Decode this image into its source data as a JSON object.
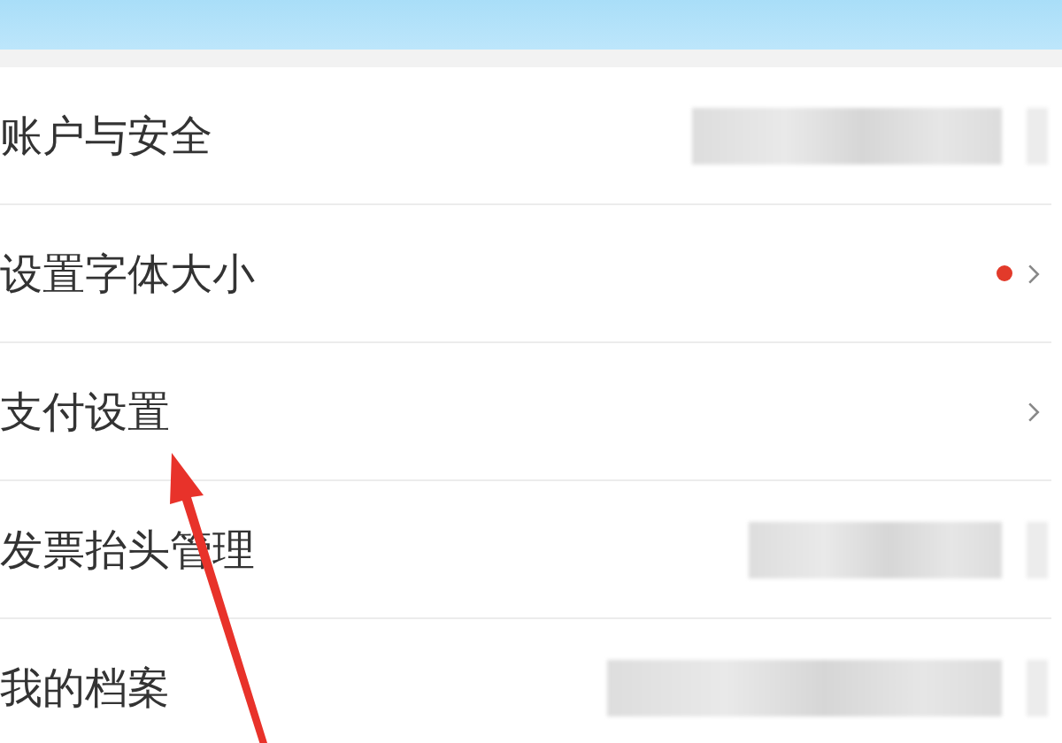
{
  "settings": [
    {
      "label": "账户与安全",
      "kind": "blurred",
      "badge": false
    },
    {
      "label": "设置字体大小",
      "kind": "chevron",
      "badge": true
    },
    {
      "label": "支付设置",
      "kind": "chevron",
      "badge": false
    },
    {
      "label": "发票抬头管理",
      "kind": "blurred",
      "badge": false
    },
    {
      "label": "我的档案",
      "kind": "blurred",
      "badge": false
    }
  ],
  "annotation": {
    "kind": "arrow"
  }
}
